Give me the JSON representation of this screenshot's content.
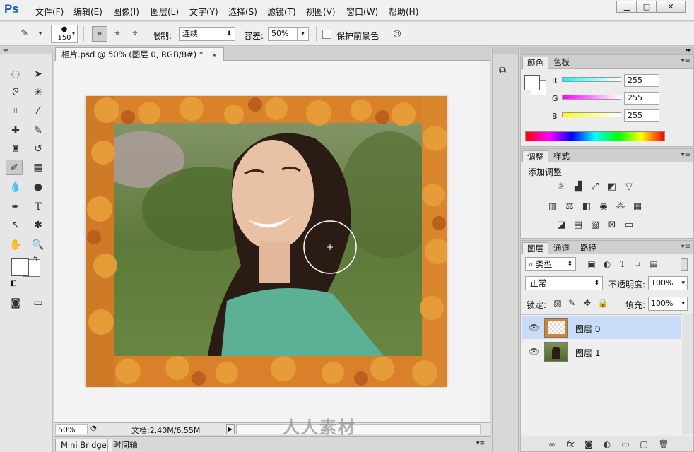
{
  "app": {
    "logo": "Ps"
  },
  "menu": [
    "文件(F)",
    "编辑(E)",
    "图像(I)",
    "图层(L)",
    "文字(Y)",
    "选择(S)",
    "滤镜(T)",
    "视图(V)",
    "窗口(W)",
    "帮助(H)"
  ],
  "window_controls": {
    "minimize": "▁",
    "maximize": "□",
    "close": "✕"
  },
  "options": {
    "brush_size": "150",
    "limit_label": "限制:",
    "limit_value": "连续",
    "tolerance_label": "容差:",
    "tolerance_value": "50%",
    "protect_fg_label": "保护前景色"
  },
  "document": {
    "tab_title": "相片.psd @ 50% (图层 0, RGB/8#) *",
    "zoom": "50%",
    "doc_info": "文档:2.40M/6.55M"
  },
  "bottom_tabs": [
    "Mini Bridge",
    "时间轴"
  ],
  "color_panel": {
    "tabs": [
      "颜色",
      "色板"
    ],
    "channels": [
      {
        "label": "R",
        "value": "255",
        "color": "#00e0e0"
      },
      {
        "label": "G",
        "value": "255",
        "color": "#e000e0"
      },
      {
        "label": "B",
        "value": "255",
        "color": "#e0e000"
      }
    ]
  },
  "adjust_panel": {
    "tabs": [
      "调整",
      "样式"
    ],
    "title": "添加调整"
  },
  "layers_panel": {
    "tabs": [
      "图层",
      "通道",
      "路径"
    ],
    "filter_label": "类型",
    "blend_mode": "正常",
    "opacity_label": "不透明度:",
    "opacity_value": "100%",
    "lock_label": "锁定:",
    "fill_label": "填充:",
    "fill_value": "100%",
    "layers": [
      {
        "name": "图层 0",
        "selected": true
      },
      {
        "name": "图层 1",
        "selected": false
      }
    ]
  },
  "watermark": "人人素材",
  "colors": {
    "accent": "#1d5fb5",
    "selected_layer": "#c9dcf7"
  }
}
